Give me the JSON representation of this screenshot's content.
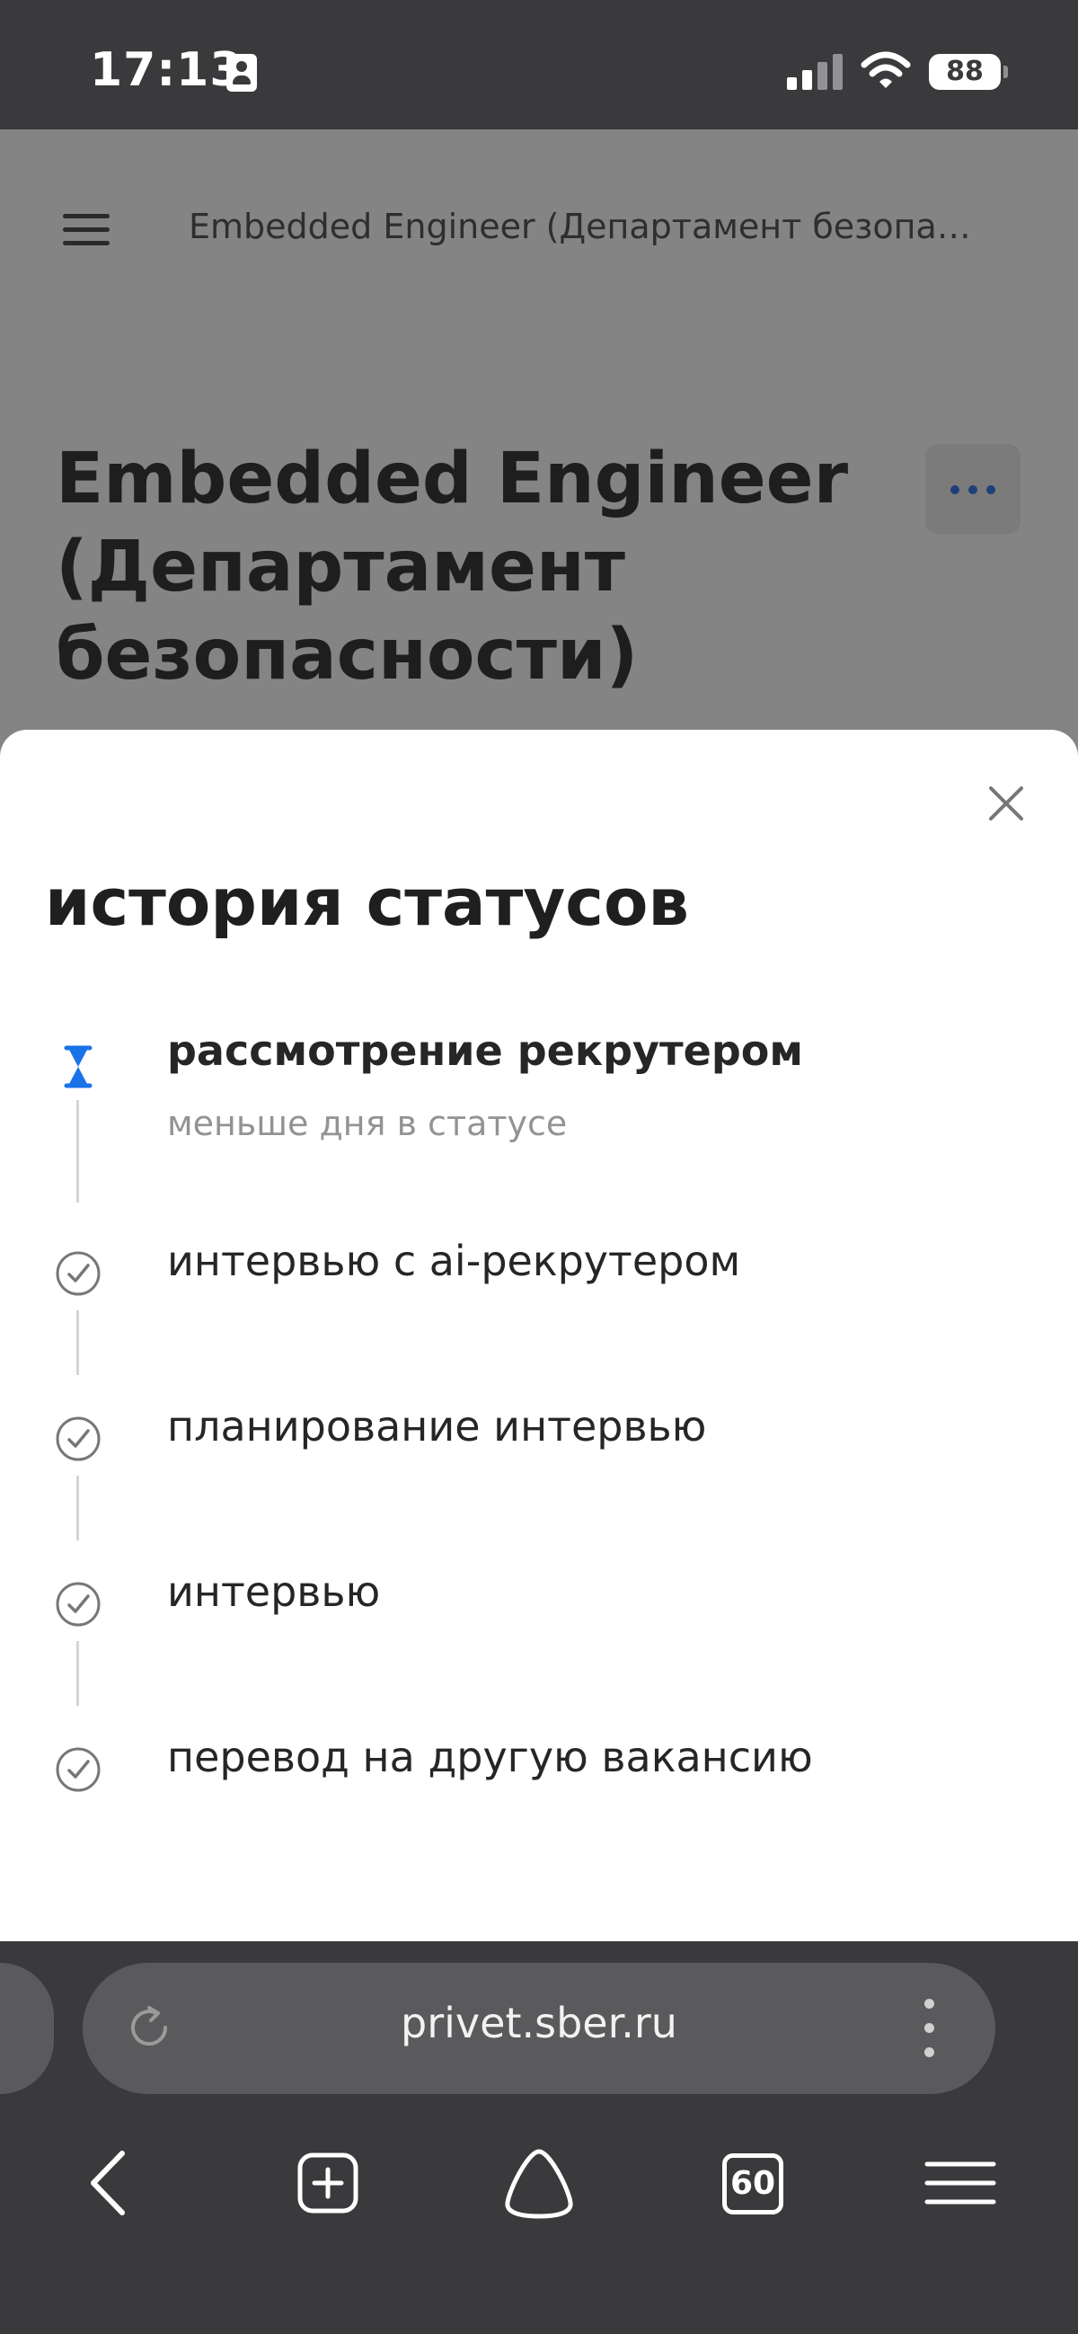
{
  "status_bar": {
    "time": "17:13",
    "battery": "88",
    "icons": [
      "contact-card-icon",
      "cellular-signal-icon",
      "wifi-icon",
      "battery-icon"
    ]
  },
  "page": {
    "header_title": "Embedded Engineer (Департамент безопа…",
    "title_lines": [
      "Embedded Engineer",
      "(Департамент",
      "безопасности)"
    ],
    "more_icon": "more-horizontal-icon",
    "accent_color": "#1e3f78"
  },
  "status_history": {
    "title": "история статусов",
    "items": [
      {
        "label": "рассмотрение рекрутером",
        "sub": "меньше дня в статусе",
        "icon": "hourglass-icon",
        "current": true
      },
      {
        "label": "интервью с ai-рекрутером",
        "icon": "check-circle-icon",
        "current": false
      },
      {
        "label": "планирование интервью",
        "icon": "check-circle-icon",
        "current": false
      },
      {
        "label": "интервью",
        "icon": "check-circle-icon",
        "current": false
      },
      {
        "label": "перевод на другую вакансию",
        "icon": "check-circle-icon",
        "current": false
      }
    ],
    "current_color": "#1a73e8"
  },
  "browser": {
    "url": "privet.sber.ru",
    "tabs_count": "60",
    "nav_icons": [
      "back-icon",
      "new-tab-icon",
      "home-icon",
      "tabs-icon",
      "menu-icon"
    ]
  }
}
